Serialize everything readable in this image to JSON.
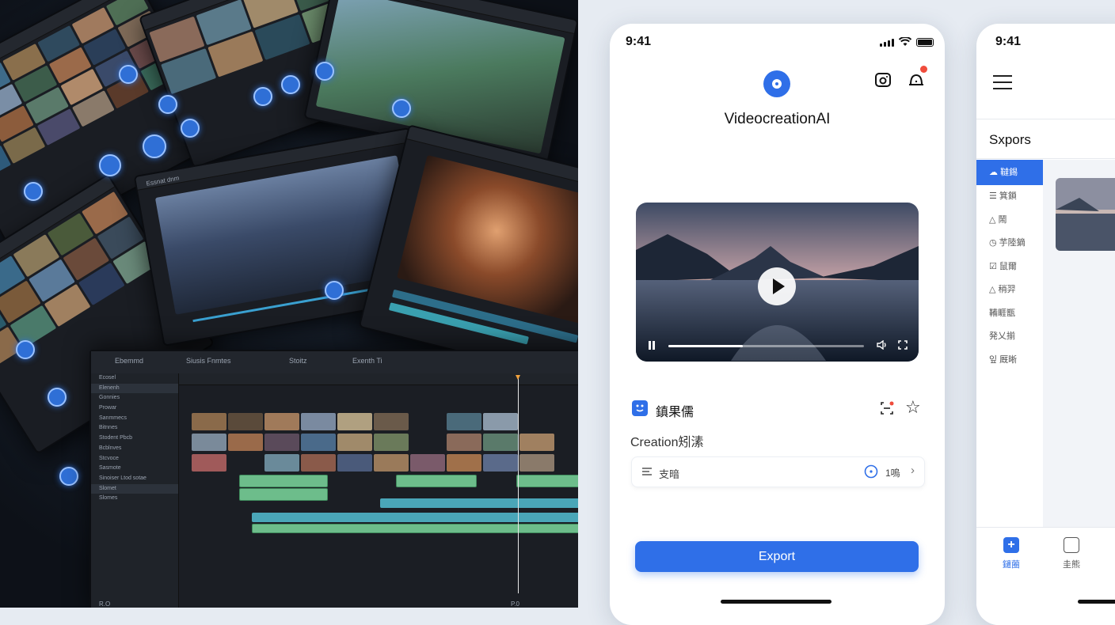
{
  "collage": {
    "preview_label": "Essnat dnm",
    "editor": {
      "header_labels": [
        "Ebemmd",
        "Siusis Fnmtes",
        "Stoitz",
        "Exenth Ti"
      ],
      "sidebar_items": [
        "Ecosel",
        "Elenenh",
        "Gonnies",
        "Prowar",
        "Sanmmecs",
        "Bitnnes",
        "Stodent Pbcb",
        "Bcblnves",
        "Stcvoce",
        "Sasmote",
        "Sinoiser Ltod sotae",
        "Slomet",
        "Slomes"
      ],
      "footer_left": "R.O",
      "footer_right": "P.0"
    }
  },
  "main_phone": {
    "status_time": "9:41",
    "app_name": "VideocreationAI",
    "video": {
      "progress": 0.38
    },
    "info_title": "鎮果儒",
    "subtitle": "Creation矧溸",
    "setting": {
      "label": "支暗",
      "value": "1嗚"
    },
    "export_label": "Export",
    "colors": {
      "accent": "#2f6fe8",
      "notification": "#f04c3c"
    }
  },
  "side_phone": {
    "status_time": "9:41",
    "section_title": "Sxpors",
    "nav_items": [
      {
        "label": "韃錫",
        "icon": "cloud-icon",
        "active": true
      },
      {
        "label": "箕鎖",
        "icon": "list-icon",
        "active": false
      },
      {
        "label": "鬧",
        "icon": "bell-icon",
        "active": false
      },
      {
        "label": "芋陸鏑",
        "icon": "clock-icon",
        "active": false
      },
      {
        "label": "鼠爾",
        "icon": "check-icon",
        "active": false
      },
      {
        "label": "稍羿",
        "icon": "bell-icon",
        "active": false
      },
      {
        "label": "鞴睚甑",
        "icon": "",
        "active": false
      },
      {
        "label": "発乂揃",
        "icon": "",
        "active": false
      },
      {
        "label": "잎 厩晰",
        "icon": "",
        "active": false
      }
    ],
    "tabs": [
      {
        "label": "鑓蔨",
        "icon": "plus-icon",
        "active": true
      },
      {
        "label": "圭熊",
        "icon": "lock-icon",
        "active": false
      }
    ]
  }
}
